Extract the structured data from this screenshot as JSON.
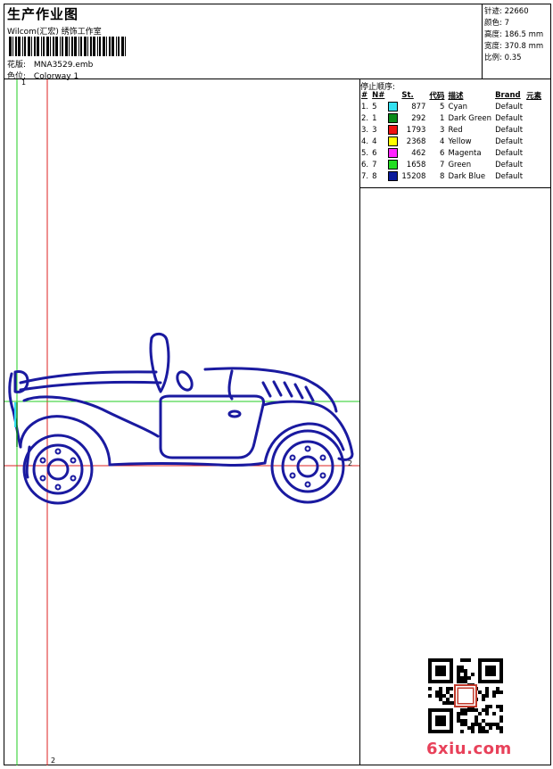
{
  "header": {
    "title": "生产作业图",
    "company": "Wilcom(汇宏) 绣饰工作室",
    "design_label": "花版:",
    "design_value": "MNA3529.emb",
    "colorway_label": "色位:",
    "colorway_value": "Colorway 1"
  },
  "stats": [
    {
      "label": "针迹:",
      "value": "22660"
    },
    {
      "label": "颜色:",
      "value": "7"
    },
    {
      "label": "高度:",
      "value": "186.5 mm"
    },
    {
      "label": "宽度:",
      "value": "370.8 mm"
    },
    {
      "label": "比例:",
      "value": "0.35"
    }
  ],
  "stop_sequence": {
    "title": "停止顺序:",
    "headers": [
      "#",
      "N#",
      "",
      "St.",
      "代码",
      "描述",
      "Brand",
      "元素"
    ],
    "rows": [
      {
        "idx": "1.",
        "num": "5",
        "color": "#33e0f0",
        "stitches": "877",
        "code": "5",
        "desc": "Cyan",
        "brand": "Default"
      },
      {
        "idx": "2.",
        "num": "1",
        "color": "#0a8a1a",
        "stitches": "292",
        "code": "1",
        "desc": "Dark Green",
        "brand": "Default"
      },
      {
        "idx": "3.",
        "num": "3",
        "color": "#ee1111",
        "stitches": "1793",
        "code": "3",
        "desc": "Red",
        "brand": "Default"
      },
      {
        "idx": "4.",
        "num": "4",
        "color": "#ffff00",
        "stitches": "2368",
        "code": "4",
        "desc": "Yellow",
        "brand": "Default"
      },
      {
        "idx": "5.",
        "num": "6",
        "color": "#ff22ff",
        "stitches": "462",
        "code": "6",
        "desc": "Magenta",
        "brand": "Default"
      },
      {
        "idx": "6.",
        "num": "7",
        "color": "#22dd22",
        "stitches": "1658",
        "code": "7",
        "desc": "Green",
        "brand": "Default"
      },
      {
        "idx": "7.",
        "num": "8",
        "color": "#0a1a9a",
        "stitches": "15208",
        "code": "8",
        "desc": "Dark Blue",
        "brand": "Default"
      }
    ]
  },
  "markers": {
    "top_left": "1",
    "right": "2",
    "bottom": "2"
  },
  "watermark": "6xiu.com",
  "colors": {
    "outline": "#1a1aa0",
    "guide_green": "#22cc22",
    "guide_red": "#dd2222"
  }
}
